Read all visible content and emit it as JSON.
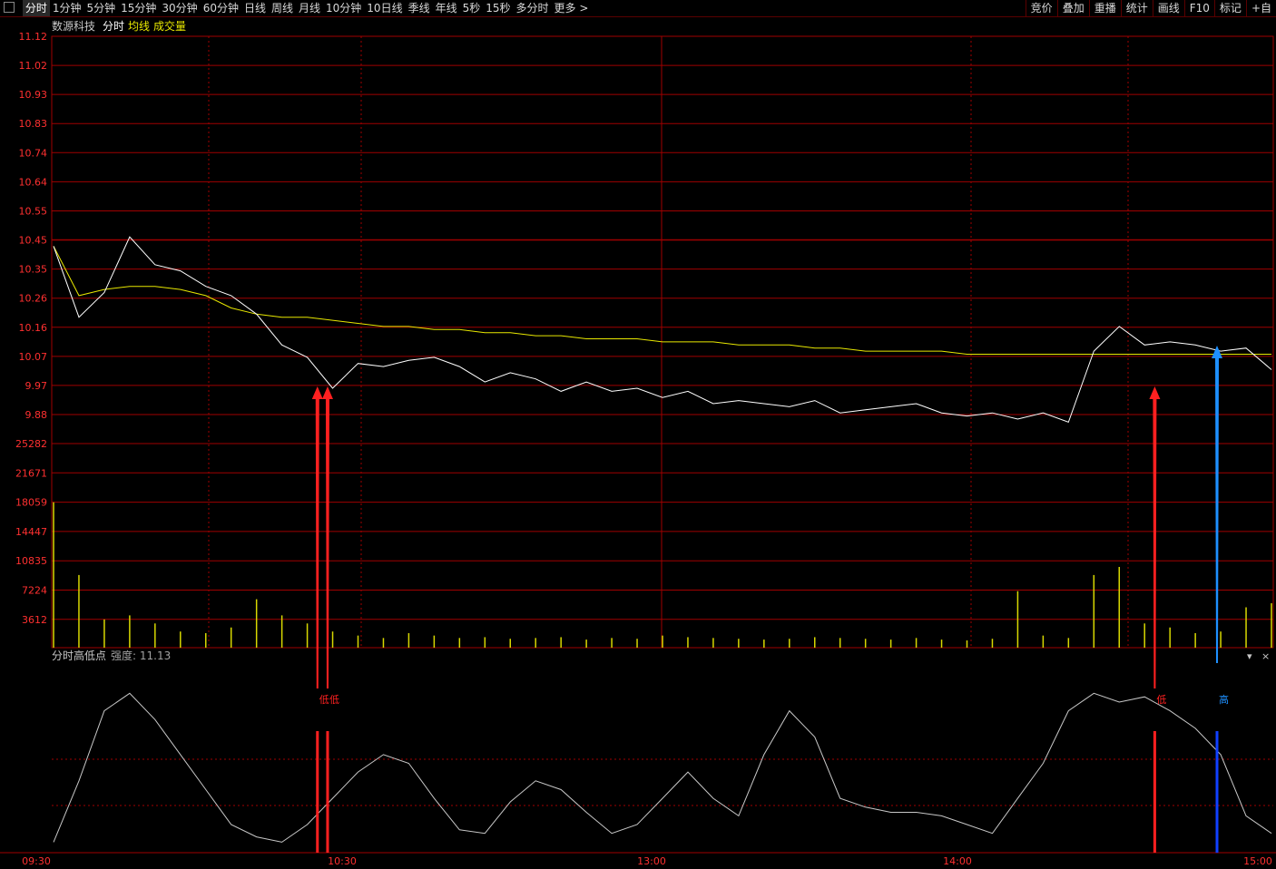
{
  "topbar": {
    "tabs": [
      "分时",
      "1分钟",
      "5分钟",
      "15分钟",
      "30分钟",
      "60分钟",
      "日线",
      "周线",
      "月线",
      "10分钟",
      "10日线",
      "季线",
      "年线",
      "5秒",
      "15秒",
      "多分时",
      "更多 >"
    ],
    "right": [
      "竞价",
      "叠加",
      "重播",
      "统计",
      "画线",
      "F10",
      "标记",
      "+自"
    ]
  },
  "header": {
    "stock": "数源科技",
    "period": "分时",
    "avg_label": "均线",
    "vol_label": "成交量"
  },
  "indicator": {
    "name": "分时高低点",
    "strength": "强度: 11.13",
    "low_label": "低",
    "high_label": "高"
  },
  "colors": {
    "price": "#ffffff",
    "avg": "#e8e800",
    "grid": "#a00000",
    "axis_text": "#ff3030",
    "low_arrow": "#ff2020",
    "high_arrow": "#1e90ff",
    "volume": "#d8d800"
  },
  "chart_data": {
    "type": "line",
    "price_ticks": [
      "11.12",
      "11.02",
      "10.93",
      "10.83",
      "10.74",
      "10.64",
      "10.55",
      "10.45",
      "10.35",
      "10.26",
      "10.16",
      "10.07",
      "9.97",
      "9.88"
    ],
    "volume_ticks": [
      "25282",
      "21671",
      "18059",
      "14447",
      "10835",
      "7224",
      "3612"
    ],
    "time_ticks": [
      "09:30",
      "10:30",
      "13:00",
      "14:00",
      "15:00"
    ],
    "ylim_price": [
      9.83,
      11.12
    ],
    "ylim_volume": [
      0,
      25282
    ],
    "x": [
      0,
      5,
      10,
      15,
      20,
      25,
      30,
      35,
      40,
      45,
      50,
      55,
      60,
      65,
      70,
      75,
      80,
      85,
      90,
      95,
      100,
      105,
      110,
      115,
      120,
      125,
      130,
      135,
      140,
      145,
      150,
      155,
      160,
      165,
      170,
      175,
      180,
      185,
      190,
      195,
      200,
      205,
      210,
      215,
      220,
      225,
      230,
      235,
      240
    ],
    "price": [
      10.44,
      10.21,
      10.29,
      10.47,
      10.38,
      10.36,
      10.31,
      10.28,
      10.22,
      10.12,
      10.08,
      9.98,
      10.06,
      10.05,
      10.07,
      10.08,
      10.05,
      10.0,
      10.03,
      10.01,
      9.97,
      10.0,
      9.97,
      9.98,
      9.95,
      9.97,
      9.93,
      9.94,
      9.93,
      9.92,
      9.94,
      9.9,
      9.91,
      9.92,
      9.93,
      9.9,
      9.89,
      9.9,
      9.88,
      9.9,
      9.87,
      10.1,
      10.18,
      10.12,
      10.13,
      10.12,
      10.1,
      10.11,
      10.04
    ],
    "avg": [
      10.44,
      10.28,
      10.3,
      10.31,
      10.31,
      10.3,
      10.28,
      10.24,
      10.22,
      10.21,
      10.21,
      10.2,
      10.19,
      10.18,
      10.18,
      10.17,
      10.17,
      10.16,
      10.16,
      10.15,
      10.15,
      10.14,
      10.14,
      10.14,
      10.13,
      10.13,
      10.13,
      10.12,
      10.12,
      10.12,
      10.11,
      10.11,
      10.1,
      10.1,
      10.1,
      10.1,
      10.09,
      10.09,
      10.09,
      10.09,
      10.09,
      10.09,
      10.09,
      10.09,
      10.09,
      10.09,
      10.09,
      10.09,
      10.09
    ],
    "volume": [
      18000,
      9000,
      3500,
      4000,
      3000,
      2000,
      1800,
      2500,
      6000,
      4000,
      3000,
      2000,
      1500,
      1200,
      1800,
      1500,
      1200,
      1300,
      1100,
      1200,
      1300,
      1000,
      1200,
      1100,
      1500,
      1300,
      1200,
      1100,
      1000,
      1100,
      1300,
      1200,
      1100,
      1000,
      1200,
      1000,
      900,
      1100,
      7000,
      1500,
      1200,
      9000,
      10000,
      3000,
      2500,
      1800,
      2000,
      5000,
      5500
    ],
    "indicator": [
      0.05,
      0.4,
      0.8,
      0.9,
      0.75,
      0.55,
      0.35,
      0.15,
      0.08,
      0.05,
      0.15,
      0.3,
      0.45,
      0.55,
      0.5,
      0.3,
      0.12,
      0.1,
      0.28,
      0.4,
      0.35,
      0.22,
      0.1,
      0.15,
      0.3,
      0.45,
      0.3,
      0.2,
      0.55,
      0.8,
      0.65,
      0.3,
      0.25,
      0.22,
      0.22,
      0.2,
      0.15,
      0.1,
      0.3,
      0.5,
      0.8,
      0.9,
      0.85,
      0.88,
      0.8,
      0.7,
      0.55,
      0.2,
      0.1
    ],
    "low_markers_x": [
      52,
      54,
      217
    ],
    "high_markers_x": [
      240
    ]
  }
}
